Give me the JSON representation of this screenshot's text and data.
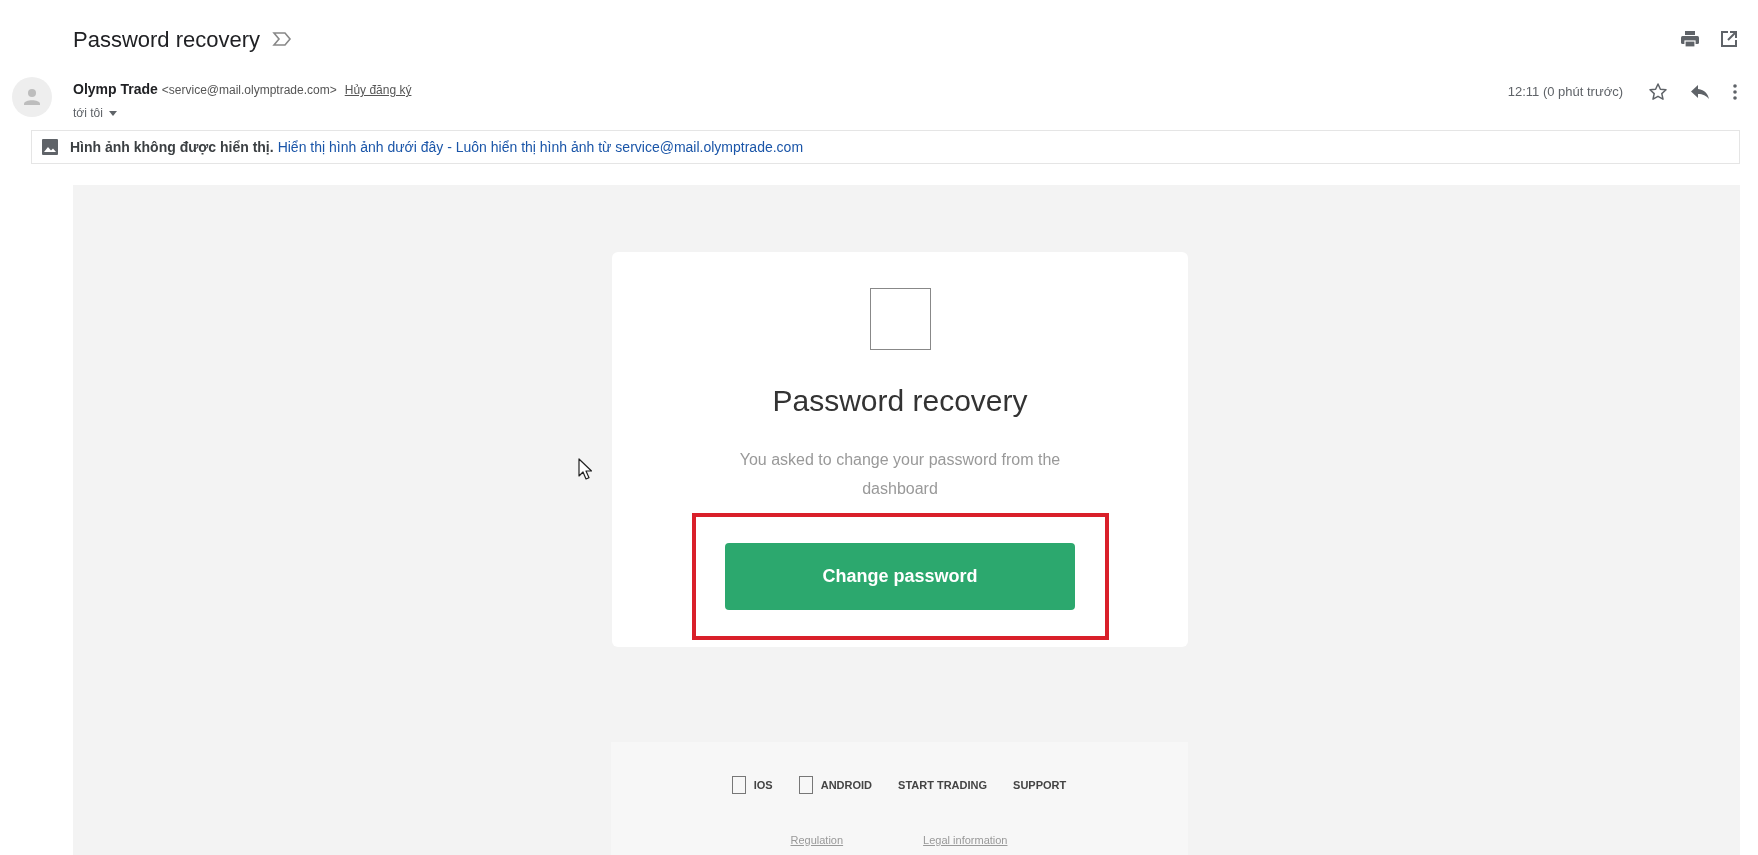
{
  "subject": "Password recovery",
  "sender": {
    "name": "Olymp Trade",
    "email": "<service@mail.olymptrade.com>",
    "unsubscribe": "Hủy đăng ký",
    "recipient": "tới tôi"
  },
  "time": "12:11 (0 phút trước)",
  "images_notice": {
    "text": "Hình ảnh không được hiển thị.",
    "link": "Hiển thị hình ảnh dưới đây - Luôn hiển thị hình ảnh từ service@mail.olymptrade.com"
  },
  "card": {
    "title": "Password recovery",
    "message": "You asked to change your password from the dashboard",
    "button": "Change password",
    "highlighted": true
  },
  "footer": {
    "links": [
      {
        "label": "IOS",
        "kind": "app"
      },
      {
        "label": "ANDROID",
        "kind": "app"
      },
      {
        "label": "START TRADING",
        "kind": "text"
      },
      {
        "label": "SUPPORT",
        "kind": "text"
      }
    ],
    "legal": [
      "Regulation",
      "Legal information"
    ]
  }
}
